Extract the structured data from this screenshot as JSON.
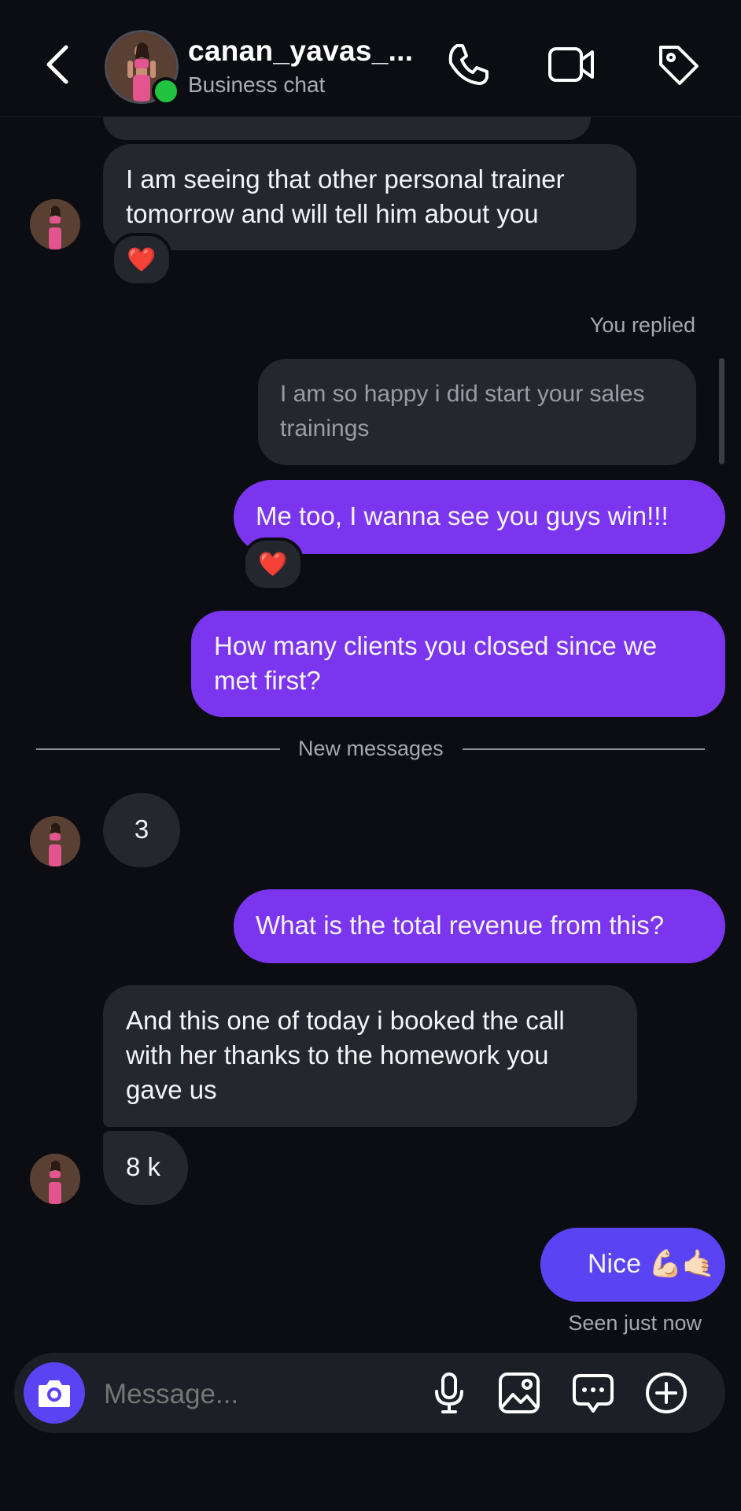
{
  "header": {
    "username": "canan_yavas_...",
    "subtitle": "Business chat",
    "icons": [
      "back-chevron-icon",
      "phone-icon",
      "video-camera-icon",
      "tag-icon"
    ],
    "online_color": "#22c33f"
  },
  "messages": {
    "m1_line1": "I am seeing that other personal trainer",
    "m1_line2": "tomorrow and will tell him about you",
    "m1_reaction": "❤️",
    "you_replied": "You replied",
    "reply_line1": "I am so happy i did start your sales",
    "reply_line2": "trainings",
    "m2": "Me too, I wanna see you guys win!!!",
    "m2_reaction": "❤️",
    "m3_line1": "How many clients you closed since we",
    "m3_line2": "met first?",
    "new_messages": "New messages",
    "m4": "3",
    "m5": "What is the total revenue from this?",
    "m6_line1": "And this one of today i booked the call",
    "m6_line2": "with her thanks to the homework you",
    "m6_line3": "gave us",
    "m7": "8 k",
    "m8": "Nice 💪🏻🤙🏻",
    "seen": "Seen just now"
  },
  "composer": {
    "placeholder": "Message...",
    "icons": [
      "camera-icon",
      "microphone-icon",
      "image-icon",
      "sticker-chat-icon",
      "plus-circle-icon"
    ]
  },
  "colors": {
    "background": "#0b0d13",
    "incoming": "#25272e",
    "outgoing": "#7b35ee",
    "accent": "#5a43f2"
  }
}
